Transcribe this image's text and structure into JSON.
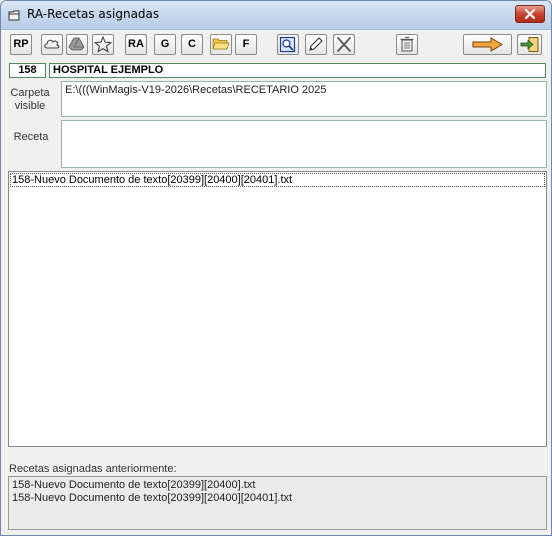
{
  "window": {
    "title": "RA-Recetas asignadas"
  },
  "toolbar": {
    "rp": "RP",
    "ra": "RA",
    "g": "G",
    "c": "C",
    "f": "F"
  },
  "record": {
    "code": "158",
    "name": "HOSPITAL EJEMPLO"
  },
  "form": {
    "folder_label_line1": "Carpeta",
    "folder_label_line2": "visible",
    "folder_value": "E:\\(((WinMagis-V19-2026\\Recetas\\RECETARIO 2025",
    "recipe_label": "Receta",
    "recipe_value": ""
  },
  "files": [
    "158-Nuevo Documento de texto[20399][20400][20401].txt"
  ],
  "previous": {
    "label": "Recetas asignadas anteriormente:",
    "items": [
      "158-Nuevo Documento de texto[20399][20400].txt",
      "158-Nuevo Documento de texto[20399][20400][20401].txt"
    ]
  }
}
